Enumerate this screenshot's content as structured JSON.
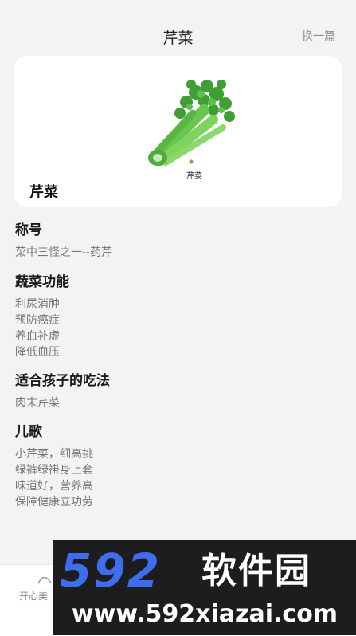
{
  "header": {
    "title": "芹菜",
    "switch_label": "换一篇"
  },
  "card": {
    "name": "芹菜",
    "illustration_caption": "芹菜"
  },
  "sections": [
    {
      "heading": "称号",
      "lines": [
        "菜中三怪之一--药芹"
      ]
    },
    {
      "heading": "蔬菜功能",
      "lines": [
        "利尿消肿",
        "预防癌症",
        "养血补虚",
        "降低血压"
      ]
    },
    {
      "heading": "适合孩子的吃法",
      "lines": [
        "肉末芹菜"
      ]
    },
    {
      "heading": "儿歌",
      "lines": [
        "小芹菜，细高挑",
        "绿裤绿褂身上套",
        "味道好，营养高",
        "保障健康立功劳"
      ]
    }
  ],
  "tabbar": {
    "tab_label": "开心美"
  },
  "watermark": {
    "number": "592",
    "brand": "软件园",
    "url": "www.592xiazai.com"
  },
  "colors": {
    "watermark_blue": "#3f6df0",
    "celery_green": "#5fbf4a"
  }
}
